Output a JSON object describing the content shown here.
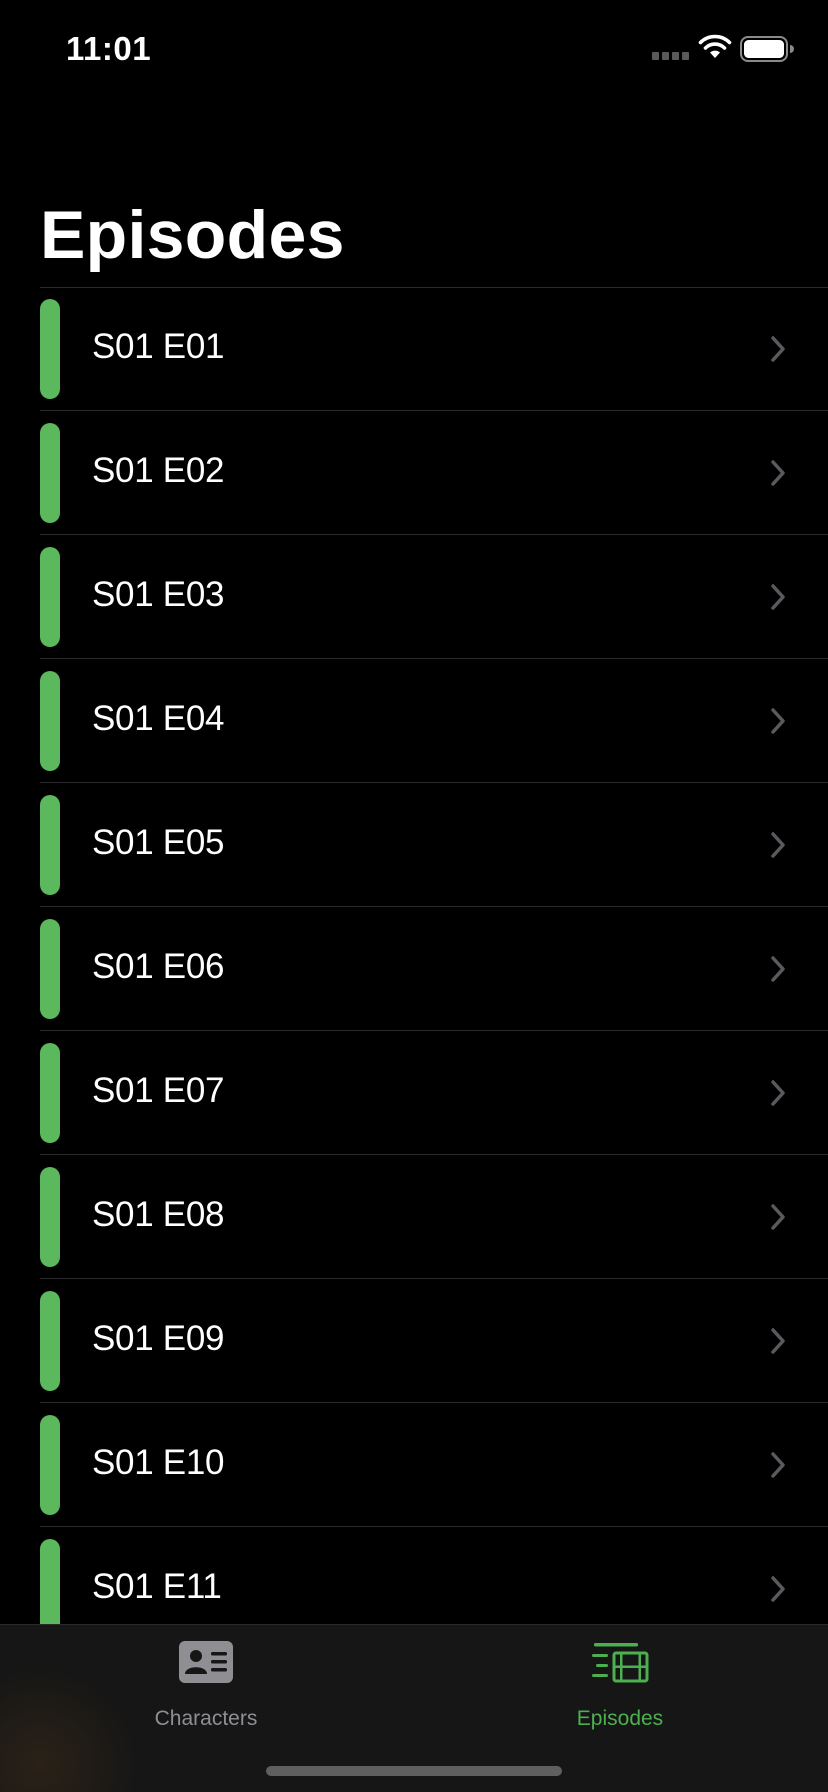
{
  "status_bar": {
    "time": "11:01"
  },
  "header": {
    "title": "Episodes"
  },
  "episodes": [
    {
      "label": "S01 E01"
    },
    {
      "label": "S01 E02"
    },
    {
      "label": "S01 E03"
    },
    {
      "label": "S01 E04"
    },
    {
      "label": "S01 E05"
    },
    {
      "label": "S01 E06"
    },
    {
      "label": "S01 E07"
    },
    {
      "label": "S01 E08"
    },
    {
      "label": "S01 E09"
    },
    {
      "label": "S01 E10"
    },
    {
      "label": "S01 E11"
    }
  ],
  "tab_bar": {
    "tabs": [
      {
        "label": "Characters",
        "icon": "person-card-icon",
        "selected": false
      },
      {
        "label": "Episodes",
        "icon": "film-list-icon",
        "selected": true
      }
    ]
  },
  "colors": {
    "accent": "#4caf50",
    "indicator": "#5cb85c",
    "inactive_tab": "#8e8e93",
    "background": "#000000"
  }
}
